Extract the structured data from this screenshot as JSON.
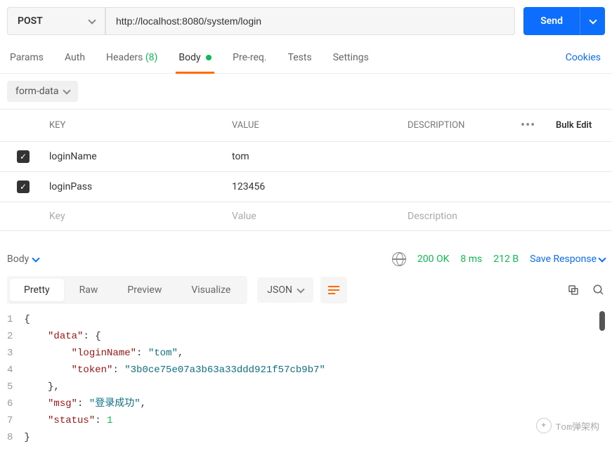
{
  "request": {
    "method": "POST",
    "url": "http://localhost:8080/system/login",
    "sendLabel": "Send"
  },
  "tabs": {
    "params": "Params",
    "auth": "Auth",
    "headersLabel": "Headers",
    "headersCount": "(8)",
    "body": "Body",
    "prereq": "Pre-req.",
    "tests": "Tests",
    "settings": "Settings",
    "cookies": "Cookies"
  },
  "bodyType": {
    "formData": "form-data"
  },
  "tableHeaders": {
    "key": "KEY",
    "value": "VALUE",
    "description": "DESCRIPTION",
    "bulkEdit": "Bulk Edit"
  },
  "params": [
    {
      "checked": true,
      "key": "loginName",
      "value": "tom"
    },
    {
      "checked": true,
      "key": "loginPass",
      "value": "123456"
    }
  ],
  "placeholders": {
    "key": "Key",
    "value": "Value",
    "description": "Description"
  },
  "response": {
    "bodyLabel": "Body",
    "statusCode": "200 OK",
    "time": "8 ms",
    "size": "212 B",
    "saveResponse": "Save Response"
  },
  "responseTabs": {
    "pretty": "Pretty",
    "raw": "Raw",
    "preview": "Preview",
    "visualize": "Visualize"
  },
  "formatSelect": "JSON",
  "jsonLines": {
    "l1": "{",
    "l2_key": "\"data\"",
    "l2_rest": ": {",
    "l3_key": "\"loginName\"",
    "l3_val": "\"tom\"",
    "l4_key": "\"token\"",
    "l4_val": "\"3b0ce75e07a3b63a33ddd921f57cb9b7\"",
    "l5": "},",
    "l6_key": "\"msg\"",
    "l6_val": "\"登录成功\"",
    "l7_key": "\"status\"",
    "l7_val": "1",
    "l8": "}"
  },
  "watermark": "Tom弹架构"
}
